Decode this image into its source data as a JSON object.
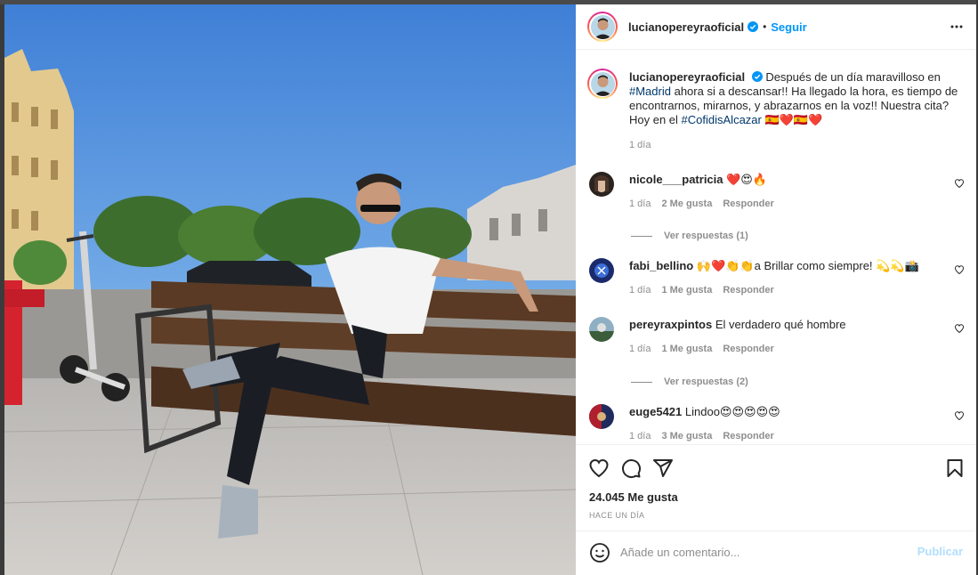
{
  "post": {
    "username": "lucianopereyraoficial",
    "separator": "•",
    "follow_label": "Seguir",
    "more_icon": "more-horizontal-icon",
    "verified_color": "#0095f6"
  },
  "caption": {
    "username": "lucianopereyraoficial",
    "text_a": "Después de un día maravilloso en",
    "tag_madrid": "#Madrid",
    "text_b": "ahora si a descansar!! Ha llegado la hora, es tiempo de encontrarnos, mirarnos, y abrazarnos en la voz!! Nuestra cita? Hoy en el",
    "tag_cofidis": "#CofidisAlcazar",
    "emojis": "🇪🇸❤️🇪🇸❤️",
    "time": "1 día"
  },
  "comments": [
    {
      "user": "nicole___patricia",
      "text": "❤️😍🔥",
      "time": "1 día",
      "likes": "2 Me gusta",
      "reply": "Responder",
      "view_replies": "Ver respuestas (1)"
    },
    {
      "user": "fabi_bellino",
      "text": "🙌❤️👏👏a Brillar como siempre! 💫💫📸",
      "time": "1 día",
      "likes": "1 Me gusta",
      "reply": "Responder"
    },
    {
      "user": "pereyraxpintos",
      "text": "El verdadero qué hombre",
      "time": "1 día",
      "likes": "1 Me gusta",
      "reply": "Responder",
      "view_replies": "Ver respuestas (2)"
    },
    {
      "user": "euge5421",
      "text": "Lindoo😍😍😍😍😍",
      "time": "1 día",
      "likes": "3 Me gusta",
      "reply": "Responder"
    }
  ],
  "actions": {
    "like_count": "24.045 Me gusta",
    "timestamp": "HACE UN DÍA",
    "icons": [
      "heart-icon",
      "comment-icon",
      "share-icon",
      "bookmark-icon"
    ]
  },
  "add_comment": {
    "placeholder": "Añade un comentario...",
    "publish_label": "Publicar",
    "emoji_icon": "emoji-icon"
  }
}
